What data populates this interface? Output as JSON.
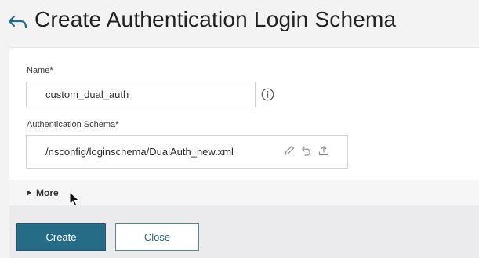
{
  "header": {
    "back_icon": "back-arrow-icon",
    "title": "Create Authentication Login Schema"
  },
  "form": {
    "name_label": "Name*",
    "name_value": "custom_dual_auth",
    "info_icon": "info-icon",
    "schema_label": "Authentication Schema*",
    "schema_value": "/nsconfig/loginschema/DualAuth_new.xml",
    "schema_actions": [
      "edit-icon",
      "undo-icon",
      "upload-icon"
    ]
  },
  "more": {
    "label": "More",
    "caret_icon": "caret-right-icon"
  },
  "footer": {
    "create_label": "Create",
    "close_label": "Close"
  },
  "colors": {
    "primary": "#276c86",
    "page_background": "#f3f3f4",
    "card_background": "#ffffff",
    "footer_background": "#ebebed"
  }
}
